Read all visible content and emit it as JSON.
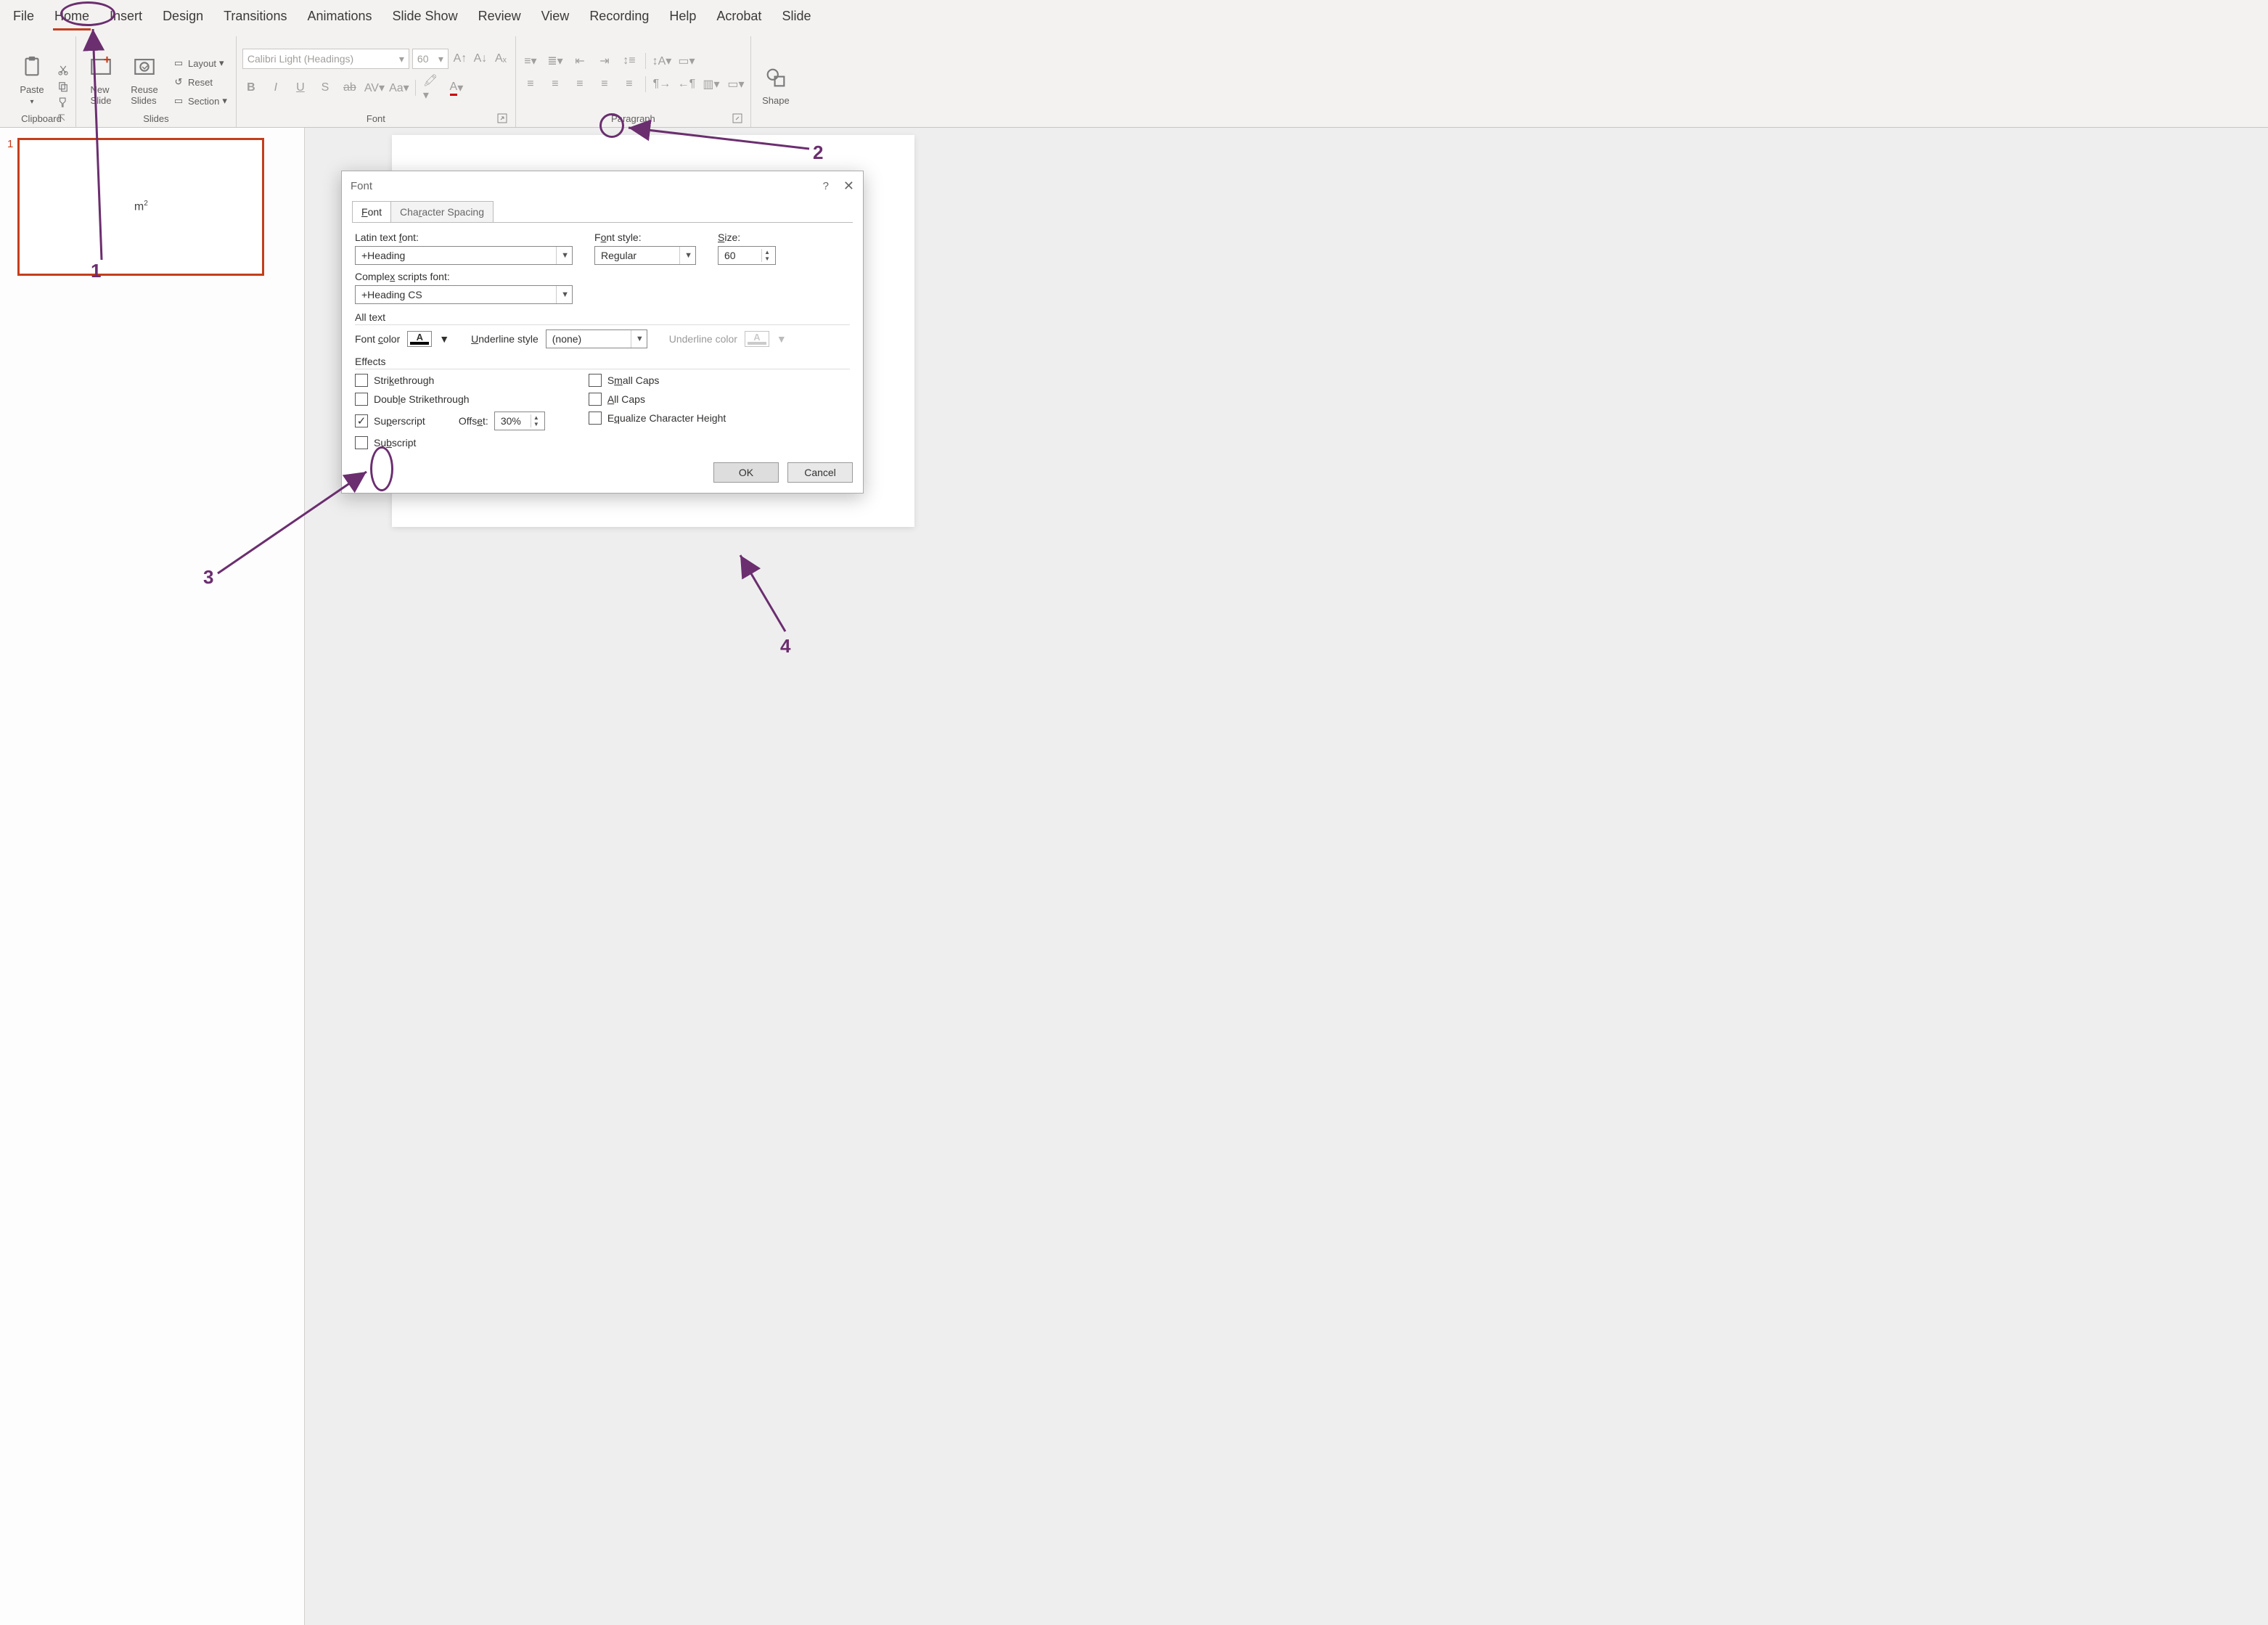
{
  "tabs": [
    "File",
    "Home",
    "Insert",
    "Design",
    "Transitions",
    "Animations",
    "Slide Show",
    "Review",
    "View",
    "Recording",
    "Help",
    "Acrobat",
    "Slide"
  ],
  "active_tab_index": 1,
  "ribbon": {
    "clipboard": {
      "label": "Clipboard",
      "paste": "Paste"
    },
    "slides": {
      "label": "Slides",
      "new_slide": "New\nSlide",
      "reuse": "Reuse\nSlides",
      "layout": "Layout",
      "reset": "Reset",
      "section": "Section"
    },
    "font": {
      "label": "Font",
      "font_name": "Calibri Light (Headings)",
      "font_size": "60"
    },
    "paragraph": {
      "label": "Paragraph"
    },
    "shapes": {
      "label": "Shape"
    }
  },
  "thumbnail": {
    "number": "1",
    "text_base": "m",
    "text_sup": "2"
  },
  "dialog": {
    "title": "Font",
    "tab_font": "Font",
    "tab_spacing": "Character Spacing",
    "labels": {
      "latin_font": "Latin text font:",
      "font_style": "Font style:",
      "size": "Size:",
      "complex_font": "Complex scripts font:",
      "all_text": "All text",
      "font_color": "Font color",
      "underline_style": "Underline style",
      "underline_color": "Underline color",
      "effects": "Effects",
      "offset": "Offset:"
    },
    "values": {
      "latin_font": "+Heading",
      "font_style": "Regular",
      "size": "60",
      "complex_font": "+Heading CS",
      "underline_style": "(none)",
      "offset": "30%"
    },
    "effects": {
      "strikethrough": "Strikethrough",
      "dbl_strikethrough": "Double Strikethrough",
      "superscript": "Superscript",
      "subscript": "Subscript",
      "small_caps": "Small Caps",
      "all_caps": "All Caps",
      "equalize": "Equalize Character Height"
    },
    "buttons": {
      "ok": "OK",
      "cancel": "Cancel"
    }
  },
  "annotations": {
    "n1": "1",
    "n2": "2",
    "n3": "3",
    "n4": "4"
  }
}
